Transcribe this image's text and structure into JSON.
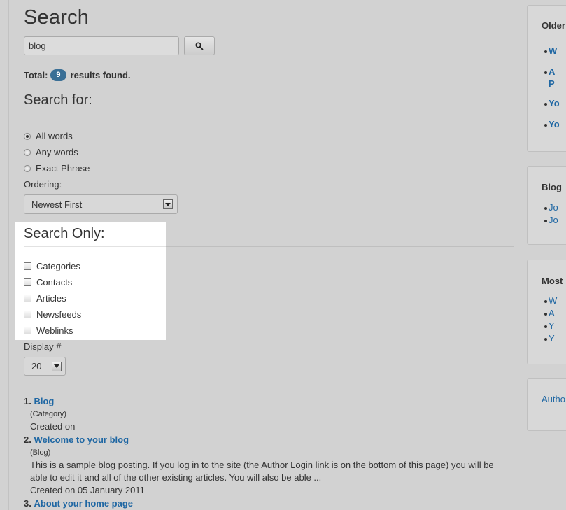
{
  "page": {
    "title": "Search"
  },
  "search": {
    "value": "blog",
    "button_icon": "magnifier-icon"
  },
  "total": {
    "label": "Total:",
    "count": "9",
    "suffix": "results found."
  },
  "search_for": {
    "heading": "Search for:",
    "options": [
      {
        "label": "All words",
        "checked": true
      },
      {
        "label": "Any words",
        "checked": false
      },
      {
        "label": "Exact Phrase",
        "checked": false
      }
    ]
  },
  "ordering": {
    "label": "Ordering:",
    "value": "Newest First"
  },
  "search_only": {
    "heading": "Search Only:",
    "options": [
      "Categories",
      "Contacts",
      "Articles",
      "Newsfeeds",
      "Weblinks"
    ]
  },
  "display": {
    "label": "Display #",
    "value": "20"
  },
  "results": [
    {
      "num": "1.",
      "title": "Blog",
      "type": "(Category)",
      "text": "",
      "created": "Created on"
    },
    {
      "num": "2.",
      "title": "Welcome to your blog",
      "type": "(Blog)",
      "text": "This is a sample blog posting. If you log in to the site (the Author Login link is on the bottom of this page) you will be able to edit it and all of the other existing articles. You will also be able ...",
      "created": "Created on 05 January 2011"
    },
    {
      "num": "3.",
      "title": "About your home page"
    }
  ],
  "sidebar": {
    "older": {
      "title": "Older",
      "items": [
        "W",
        "A",
        "P",
        "Yo",
        "Yo"
      ]
    },
    "blog": {
      "title": "Blog",
      "items": [
        "Jo",
        "Jo"
      ]
    },
    "most": {
      "title": "Most",
      "items": [
        "W",
        "A",
        "Y",
        "Y"
      ]
    },
    "author": {
      "link": "Autho"
    }
  }
}
